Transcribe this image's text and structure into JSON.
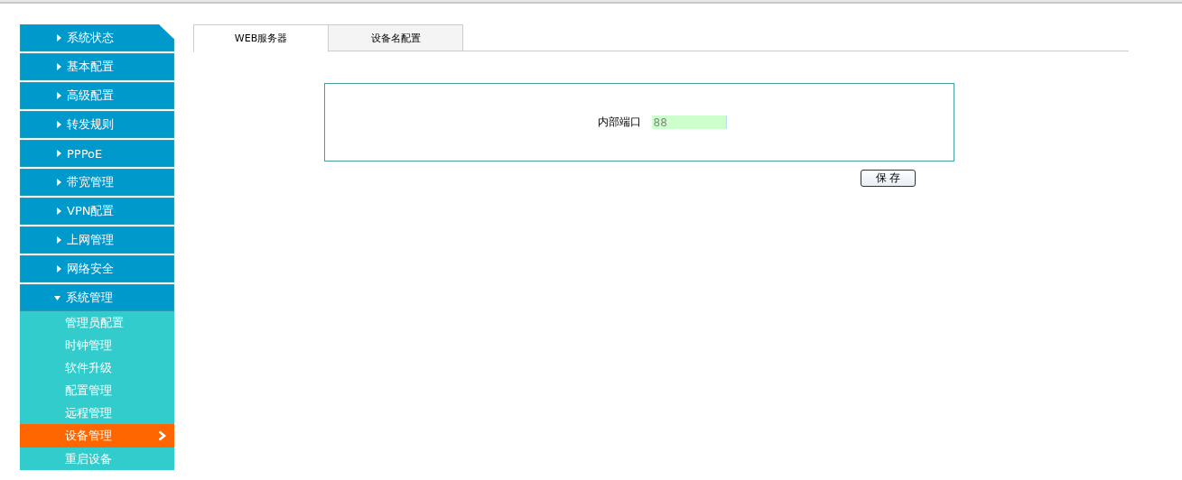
{
  "sidebar": {
    "items": [
      {
        "label": "系统状态",
        "expanded": false
      },
      {
        "label": "基本配置",
        "expanded": false
      },
      {
        "label": "高级配置",
        "expanded": false
      },
      {
        "label": "转发规则",
        "expanded": false
      },
      {
        "label": "PPPoE",
        "expanded": false
      },
      {
        "label": "带宽管理",
        "expanded": false
      },
      {
        "label": "VPN配置",
        "expanded": false
      },
      {
        "label": "上网管理",
        "expanded": false
      },
      {
        "label": "网络安全",
        "expanded": false
      },
      {
        "label": "系统管理",
        "expanded": true,
        "children": [
          {
            "label": "管理员配置",
            "selected": false
          },
          {
            "label": "时钟管理",
            "selected": false
          },
          {
            "label": "软件升级",
            "selected": false
          },
          {
            "label": "配置管理",
            "selected": false
          },
          {
            "label": "远程管理",
            "selected": false
          },
          {
            "label": "设备管理",
            "selected": true
          },
          {
            "label": "重启设备",
            "selected": false
          }
        ]
      }
    ]
  },
  "tabs": [
    {
      "label": "WEB服务器",
      "selected": true
    },
    {
      "label": "设备名配置",
      "selected": false
    }
  ],
  "form": {
    "label": "内部端口",
    "value": "88"
  },
  "buttons": [
    "保 存"
  ]
}
